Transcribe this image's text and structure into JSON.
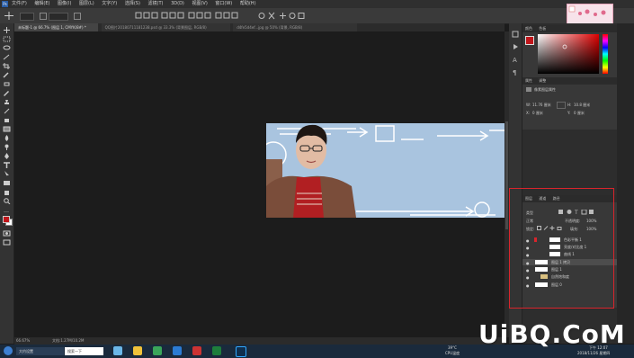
{
  "menu": [
    "文件(F)",
    "编辑(E)",
    "图像(I)",
    "图层(L)",
    "文字(Y)",
    "选择(S)",
    "滤镜(T)",
    "3D(D)",
    "视图(V)",
    "窗口(W)",
    "帮助(H)"
  ],
  "tabs": [
    {
      "label": "未标题-1 @ 66.7% (图层 1, CMYK/8#) *",
      "active": true
    },
    {
      "label": "QQ图片20180711181238.psd @ 33.3% (背景图层, RGB/8)",
      "active": false
    },
    {
      "label": "d4fe5d4ef...jpg @ 50% (背景, RGB/8)",
      "active": false
    }
  ],
  "status": {
    "zoom": "66.67%",
    "doc_size": "文档:1.27M/10.2M"
  },
  "color_panel": {
    "tabs": [
      "颜色",
      "色板"
    ],
    "accent": "#c0161b"
  },
  "properties_panel": {
    "tabs": [
      "属性",
      "调整"
    ],
    "title": "像素图层属性",
    "w_label": "W:",
    "w_value": "11.76 厘米",
    "h_label": "H:",
    "h_value": "10.8 厘米",
    "x_label": "X:",
    "x_value": "0 厘米",
    "y_label": "Y:",
    "y_value": "0 厘米"
  },
  "layers_panel": {
    "tabs": [
      "图层",
      "通道",
      "路径"
    ],
    "filter_label": "类型",
    "blend_mode": "正常",
    "opacity_label": "不透明度:",
    "opacity_value": "100%",
    "lock_label": "锁定:",
    "fill_label": "填充:",
    "fill_value": "100%",
    "layers": [
      {
        "name": "色彩平衡 1",
        "visible": true
      },
      {
        "name": "亮度/对比度 1",
        "visible": true
      },
      {
        "name": "曲线 1",
        "visible": true
      },
      {
        "name": "图层 1 拷贝",
        "visible": true,
        "selected": true
      },
      {
        "name": "图层 1",
        "visible": true
      },
      {
        "name": "自然饱和度",
        "visible": true
      },
      {
        "name": "图层 0",
        "visible": true
      }
    ]
  },
  "taskbar": {
    "apps": [
      "大约设置",
      "搜索一下"
    ],
    "temperature": "39°C",
    "cpu_label": "CPU温度",
    "time": "下午 12:07",
    "date": "2018/11/26 星期四"
  },
  "watermark": "UiBQ.CoM",
  "highlight_color": "#d8252c"
}
